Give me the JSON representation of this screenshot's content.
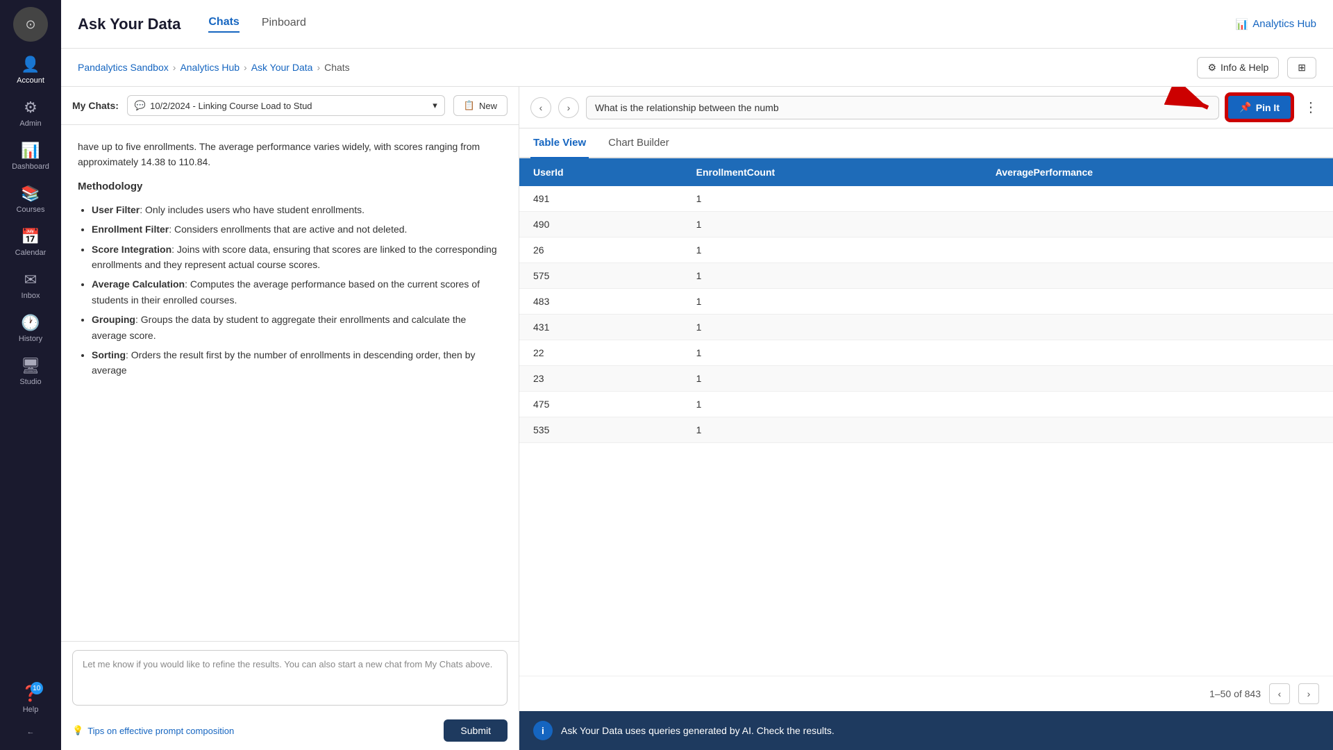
{
  "sidebar": {
    "logo_icon": "⊙",
    "items": [
      {
        "id": "account",
        "label": "Account",
        "icon": "👤"
      },
      {
        "id": "admin",
        "label": "Admin",
        "icon": "⚙"
      },
      {
        "id": "dashboard",
        "label": "Dashboard",
        "icon": "📊"
      },
      {
        "id": "courses",
        "label": "Courses",
        "icon": "📚"
      },
      {
        "id": "calendar",
        "label": "Calendar",
        "icon": "📅"
      },
      {
        "id": "inbox",
        "label": "Inbox",
        "icon": "✉"
      },
      {
        "id": "history",
        "label": "History",
        "icon": "🕐"
      },
      {
        "id": "studio",
        "label": "Studio",
        "icon": "🖥"
      },
      {
        "id": "help",
        "label": "Help",
        "icon": "❓",
        "badge": "10"
      }
    ],
    "collapse_icon": "←"
  },
  "topnav": {
    "title": "Ask Your Data",
    "tabs": [
      {
        "id": "chats",
        "label": "Chats",
        "active": true
      },
      {
        "id": "pinboard",
        "label": "Pinboard",
        "active": false
      }
    ],
    "analytics_hub_label": "Analytics Hub",
    "analytics_hub_icon": "📊"
  },
  "breadcrumb": {
    "items": [
      {
        "label": "Pandalytics Sandbox",
        "link": true
      },
      {
        "label": "Analytics Hub",
        "link": true
      },
      {
        "label": "Ask Your Data",
        "link": true
      },
      {
        "label": "Chats",
        "link": false
      }
    ]
  },
  "actions": {
    "info_help_label": "Info & Help",
    "info_help_icon": "⚙"
  },
  "chat_panel": {
    "my_chats_label": "My Chats:",
    "selected_chat": "10/2/2024 - Linking Course Load to Stud",
    "new_btn_label": "New",
    "message_content": {
      "intro": "have up to five enrollments. The average performance varies widely, with scores ranging from approximately 14.38 to 110.84.",
      "methodology_title": "Methodology",
      "points": [
        {
          "bold": "User Filter",
          "text": ": Only includes users who have student enrollments."
        },
        {
          "bold": "Enrollment Filter",
          "text": ": Considers enrollments that are active and not deleted."
        },
        {
          "bold": "Score Integration",
          "text": ": Joins with score data, ensuring that scores are linked to the corresponding enrollments and they represent actual course scores."
        },
        {
          "bold": "Average Calculation",
          "text": ": Computes the average performance based on the current scores of students in their enrolled courses."
        },
        {
          "bold": "Grouping",
          "text": ": Groups the data by student to aggregate their enrollments and calculate the average score."
        },
        {
          "bold": "Sorting",
          "text": ": Orders the result first by the number of enrollments in descending order, then by average"
        }
      ]
    },
    "input_placeholder": "Let me know if you would like to refine the results.  You can also start a new chat from My Chats above.",
    "tips_label": "Tips on effective prompt composition",
    "submit_label": "Submit"
  },
  "data_panel": {
    "query_text": "What is the relationship between the numb",
    "pin_btn_label": "Pin It",
    "pin_icon": "📌",
    "more_icon": "⋮",
    "tabs": [
      {
        "id": "table-view",
        "label": "Table View",
        "active": true
      },
      {
        "id": "chart-builder",
        "label": "Chart Builder",
        "active": false
      }
    ],
    "table": {
      "columns": [
        "UserId",
        "EnrollmentCount",
        "AveragePerformance"
      ],
      "rows": [
        {
          "userId": "491",
          "enrollmentCount": "1",
          "avgPerf": ""
        },
        {
          "userId": "490",
          "enrollmentCount": "1",
          "avgPerf": ""
        },
        {
          "userId": "26",
          "enrollmentCount": "1",
          "avgPerf": ""
        },
        {
          "userId": "575",
          "enrollmentCount": "1",
          "avgPerf": ""
        },
        {
          "userId": "483",
          "enrollmentCount": "1",
          "avgPerf": ""
        },
        {
          "userId": "431",
          "enrollmentCount": "1",
          "avgPerf": ""
        },
        {
          "userId": "22",
          "enrollmentCount": "1",
          "avgPerf": ""
        },
        {
          "userId": "23",
          "enrollmentCount": "1",
          "avgPerf": ""
        },
        {
          "userId": "475",
          "enrollmentCount": "1",
          "avgPerf": ""
        },
        {
          "userId": "535",
          "enrollmentCount": "1",
          "avgPerf": ""
        }
      ]
    },
    "pagination": {
      "range": "1–50 of 843"
    },
    "info_banner": {
      "icon": "i",
      "text": "Ask Your Data uses queries generated by AI. Check the results."
    }
  }
}
